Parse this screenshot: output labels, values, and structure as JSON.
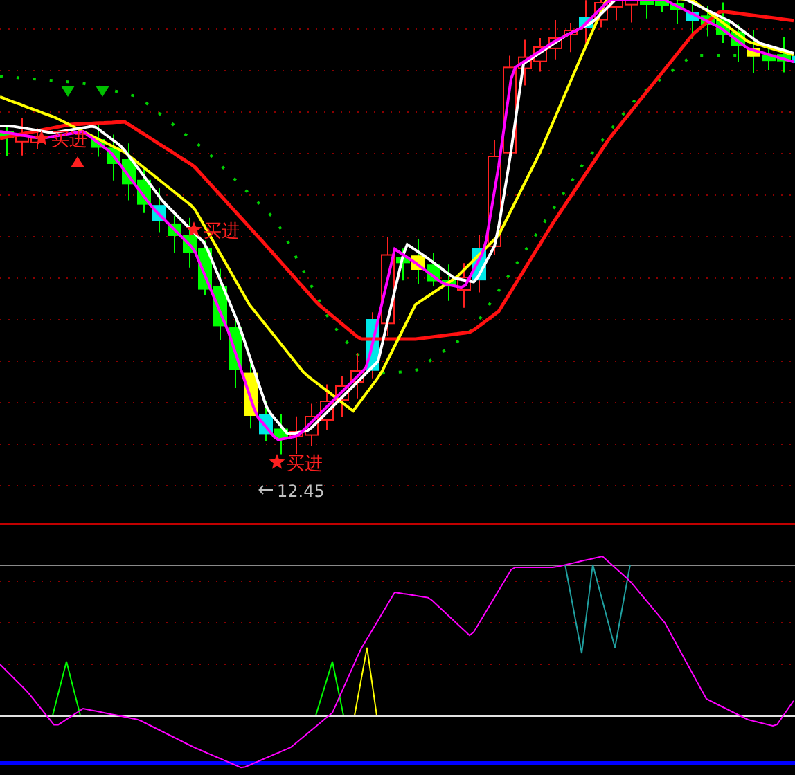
{
  "price_chart": {
    "signals": [
      {
        "label": "买进"
      },
      {
        "label": "买进"
      },
      {
        "label": "买进"
      }
    ],
    "low_price": "12.45"
  }
}
